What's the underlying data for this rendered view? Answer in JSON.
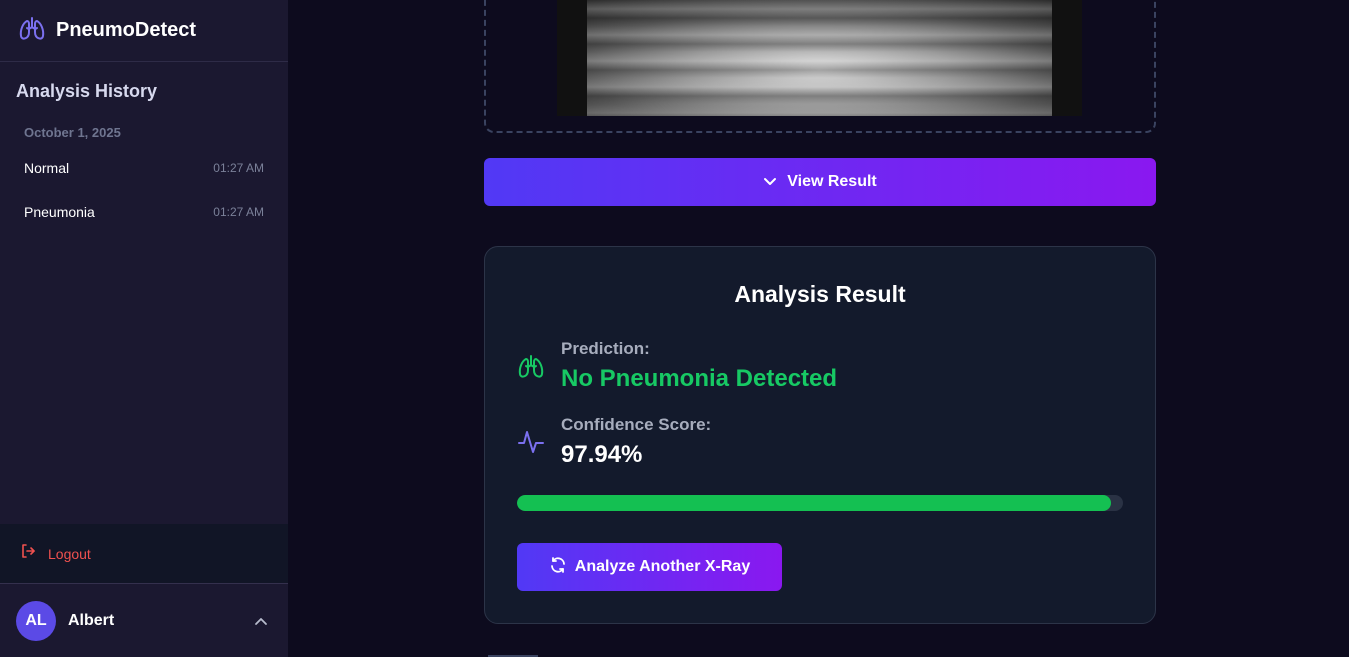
{
  "app": {
    "name": "PneumoDetect"
  },
  "sidebar": {
    "history_title": "Analysis History",
    "date_group": "October 1, 2025",
    "items": [
      {
        "label": "Normal",
        "time": "01:27 AM"
      },
      {
        "label": "Pneumonia",
        "time": "01:27 AM"
      }
    ],
    "logout_label": "Logout",
    "user": {
      "initials": "AL",
      "name": "Albert"
    }
  },
  "main": {
    "view_result_label": "View Result",
    "result": {
      "title": "Analysis Result",
      "prediction_label": "Prediction:",
      "prediction_value": "No Pneumonia Detected",
      "confidence_label": "Confidence Score:",
      "confidence_value": "97.94%",
      "confidence_fraction": 0.9794,
      "analyze_label": "Analyze Another X-Ray"
    }
  },
  "colors": {
    "accent_start": "#5139f5",
    "accent_end": "#8a18f0",
    "success": "#17c964",
    "danger": "#f0514f"
  }
}
